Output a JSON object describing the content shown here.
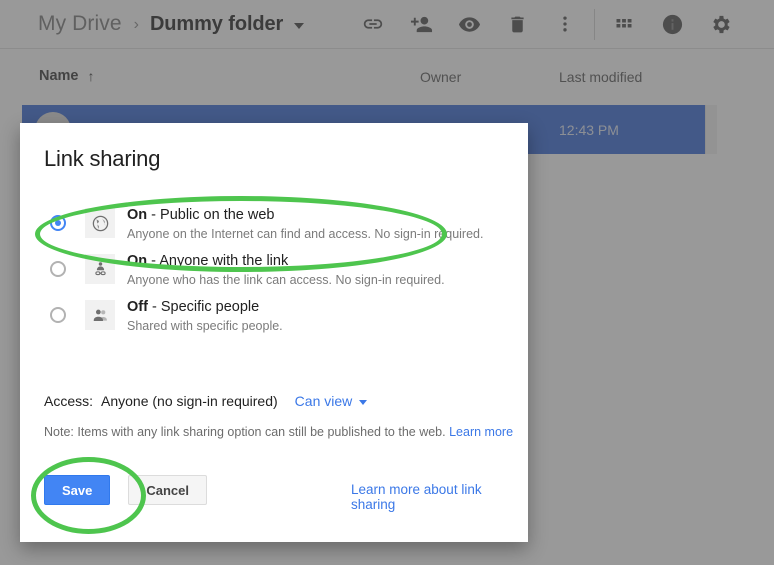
{
  "app": {
    "breadcrumb": {
      "root": "My Drive",
      "separator": "›",
      "current": "Dummy folder",
      "caret_icon": "chevron-down-icon"
    },
    "toolbar_icons": [
      "link-icon",
      "add-person-icon",
      "preview-eye-icon",
      "trash-icon",
      "more-vertical-icon",
      "grid-view-icon",
      "info-icon",
      "settings-gear-icon"
    ],
    "columns": {
      "name": "Name",
      "sort_arrow": "↑",
      "owner": "Owner",
      "last_modified": "Last modified"
    },
    "selected_row": {
      "file_icon": "pdf-file-icon",
      "name": "",
      "last_modified": "12:43 PM"
    }
  },
  "dialog": {
    "title": "Link sharing",
    "options": [
      {
        "icon": "globe-icon",
        "state": "On",
        "separator": " - ",
        "label": "Public on the web",
        "description": "Anyone on the Internet can find and access. No sign-in required.",
        "selected": true
      },
      {
        "icon": "person-link-icon",
        "state": "On",
        "separator": " - ",
        "label": "Anyone with the link",
        "description": "Anyone who has the link can access. No sign-in required.",
        "selected": false
      },
      {
        "icon": "people-group-icon",
        "state": "Off",
        "separator": " - ",
        "label": "Specific people",
        "description": "Shared with specific people.",
        "selected": false
      }
    ],
    "access": {
      "label": "Access:",
      "value": "Anyone (no sign-in required)",
      "permission": "Can view",
      "caret_icon": "chevron-down-icon"
    },
    "note": {
      "text": "Note: Items with any link sharing option can still be published to the web.",
      "link": "Learn more"
    },
    "buttons": {
      "save": "Save",
      "cancel": "Cancel",
      "learn_more": "Learn more about link sharing"
    }
  },
  "annotations": {
    "color": "#4ec54e",
    "shapes": [
      {
        "name": "highlight-public-option",
        "type": "ellipse"
      },
      {
        "name": "highlight-save-button",
        "type": "ellipse"
      }
    ]
  }
}
